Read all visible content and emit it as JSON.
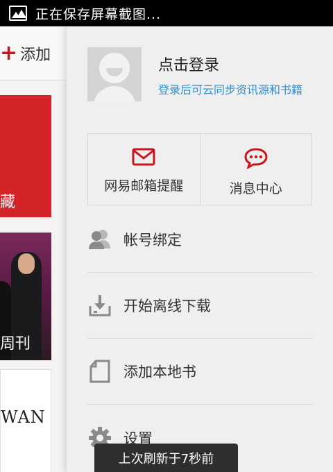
{
  "status_bar": {
    "notification_text": "正在保存屏幕截图..."
  },
  "left_panel": {
    "add_label": "添加",
    "cards": [
      {
        "label": "藏"
      },
      {
        "label": "周刊"
      },
      {
        "label": "WAN"
      }
    ]
  },
  "profile": {
    "login_title": "点击登录",
    "login_subtitle": "登录后可云同步资讯源和书籍"
  },
  "tiles": [
    {
      "label": "网易邮箱提醒",
      "icon": "mail-icon"
    },
    {
      "label": "消息中心",
      "icon": "chat-bubble-icon"
    }
  ],
  "menu": [
    {
      "label": "帐号绑定",
      "icon": "account-bind-icon"
    },
    {
      "label": "开始离线下载",
      "icon": "download-icon"
    },
    {
      "label": "添加本地书",
      "icon": "local-book-icon"
    },
    {
      "label": "设置",
      "icon": "gear-icon"
    }
  ],
  "toast": {
    "text": "上次刷新于7秒前"
  },
  "colors": {
    "accent_red": "#c9161d",
    "link_blue": "#2b8fd1"
  }
}
